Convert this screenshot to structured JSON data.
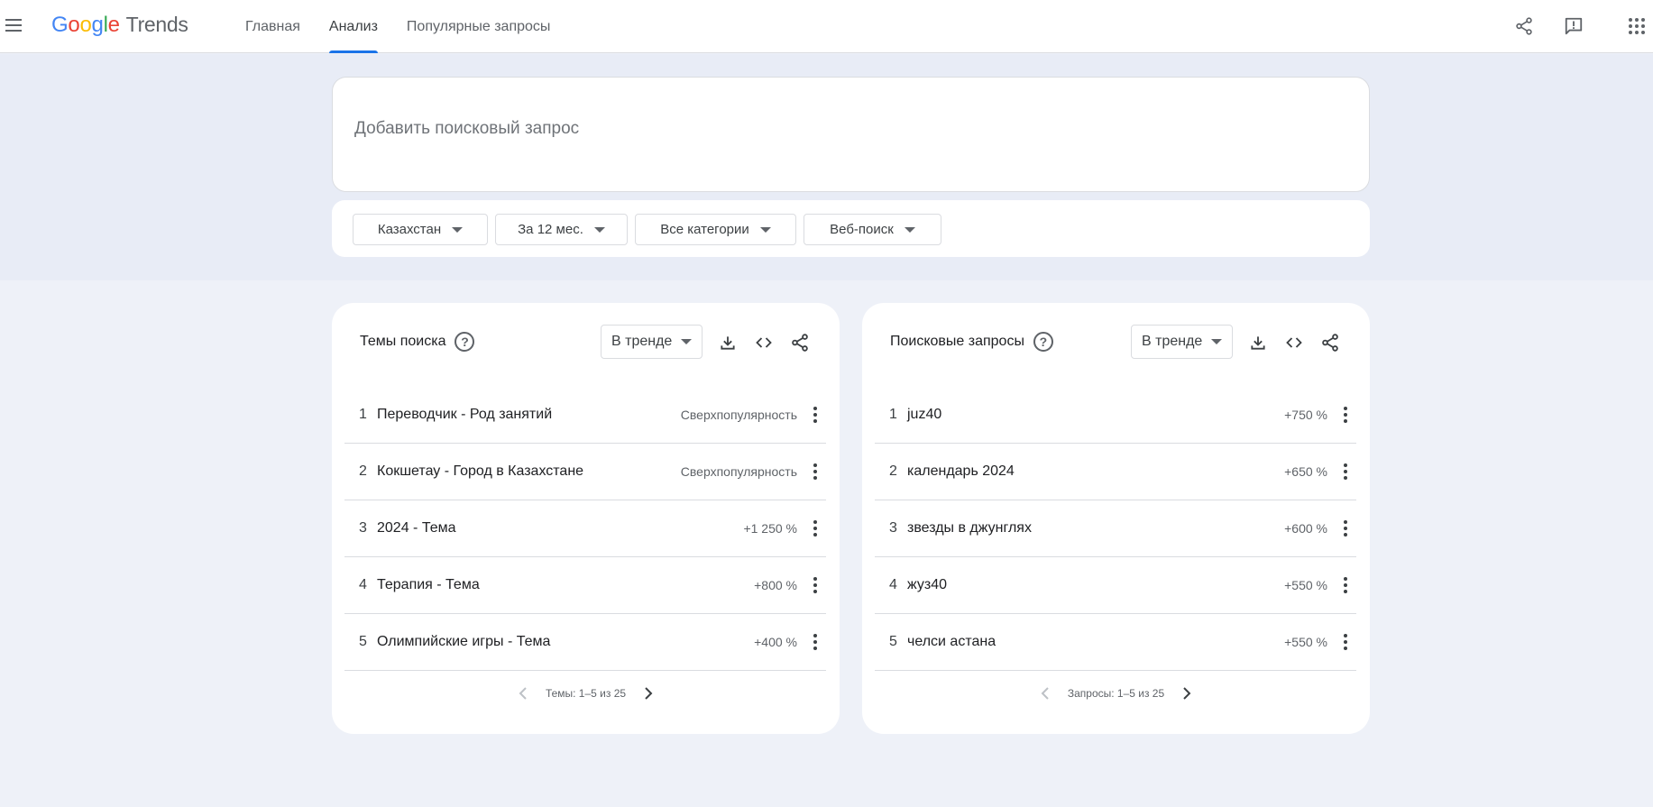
{
  "header": {
    "logo": {
      "brand": [
        "G",
        "o",
        "o",
        "g",
        "l",
        "e"
      ],
      "product": "Trends"
    },
    "tabs": [
      {
        "label": "Главная",
        "active": false
      },
      {
        "label": "Анализ",
        "active": true
      },
      {
        "label": "Популярные запросы",
        "active": false
      }
    ],
    "icons": [
      "share-icon",
      "feedback-icon",
      "apps-icon"
    ]
  },
  "search": {
    "placeholder": "Добавить поисковый запрос"
  },
  "filters": [
    {
      "label": "Казахстан"
    },
    {
      "label": "За 12 мес."
    },
    {
      "label": "Все категории"
    },
    {
      "label": "Веб-поиск"
    }
  ],
  "widgets": {
    "topics": {
      "title": "Темы поиска",
      "select": "В тренде",
      "rows": [
        {
          "num": "1",
          "label": "Переводчик - Род занятий",
          "value": "Сверхпопулярность"
        },
        {
          "num": "2",
          "label": "Кокшетау - Город в Казахстане",
          "value": "Сверхпопулярность"
        },
        {
          "num": "3",
          "label": "2024 - Тема",
          "value": "+1 250 %"
        },
        {
          "num": "4",
          "label": "Терапия - Тема",
          "value": "+800 %"
        },
        {
          "num": "5",
          "label": "Олимпийские игры - Тема",
          "value": "+400 %"
        }
      ],
      "pager": "Темы: 1–5 из 25"
    },
    "queries": {
      "title": "Поисковые запросы",
      "select": "В тренде",
      "rows": [
        {
          "num": "1",
          "label": "juz40",
          "value": "+750 %"
        },
        {
          "num": "2",
          "label": "календарь 2024",
          "value": "+650 %"
        },
        {
          "num": "3",
          "label": "звезды в джунглях",
          "value": "+600 %"
        },
        {
          "num": "4",
          "label": "жуз40",
          "value": "+550 %"
        },
        {
          "num": "5",
          "label": "челси астана",
          "value": "+550 %"
        }
      ],
      "pager": "Запросы: 1–5 из 25"
    }
  },
  "colors": {
    "accent": "#1a73e8",
    "page_bg": "#eef1f8",
    "hero_bg": "#e8ecf6"
  }
}
